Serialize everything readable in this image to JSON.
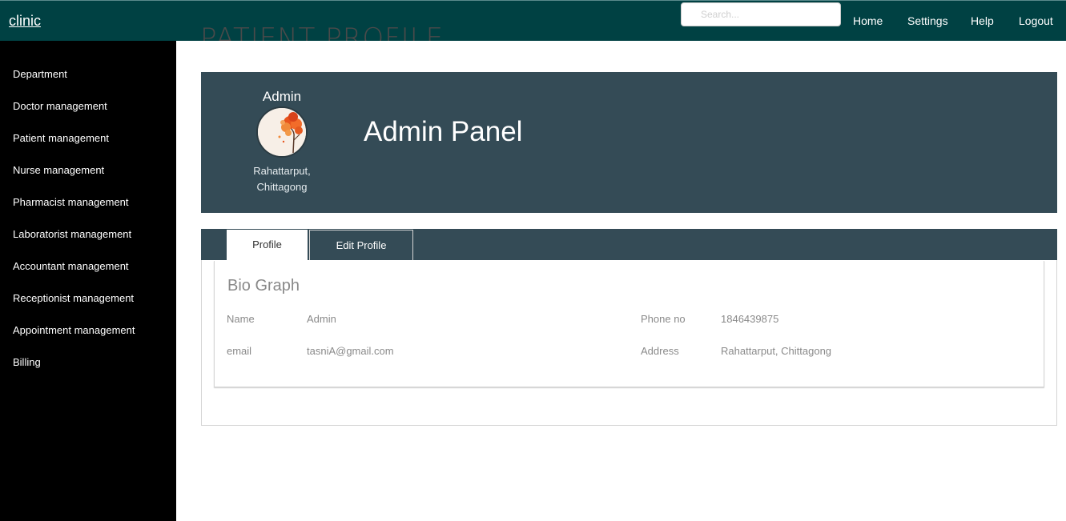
{
  "app": {
    "brand": "clinic"
  },
  "header": {
    "search_placeholder": "Search...",
    "nav": [
      "Home",
      "Settings",
      "Help",
      "Logout"
    ]
  },
  "sidebar": {
    "items": [
      {
        "label": "Department"
      },
      {
        "label": "Doctor management"
      },
      {
        "label": "Patient management"
      },
      {
        "label": "Nurse management"
      },
      {
        "label": "Pharmacist management"
      },
      {
        "label": "Laboratorist management"
      },
      {
        "label": "Accountant management"
      },
      {
        "label": "Receptionist management"
      },
      {
        "label": "Appointment management"
      },
      {
        "label": "Billing"
      }
    ]
  },
  "page": {
    "heading": "PATIENT PROFILE"
  },
  "profile": {
    "user": "Admin",
    "location_line1": "Rahattarput,",
    "location_line2": "Chittagong",
    "panel_title": "Admin Panel",
    "avatar_icon": "tree-avatar-icon"
  },
  "tabs": [
    {
      "label": "Profile",
      "active": true
    },
    {
      "label": "Edit Profile",
      "active": false
    }
  ],
  "bio": {
    "title": "Bio Graph",
    "rows": [
      {
        "left_label": "Name",
        "left_value": "Admin",
        "right_label": "Phone no",
        "right_value": "1846439875"
      },
      {
        "left_label": "email",
        "left_value": "tasniA@gmail.com",
        "right_label": "Address",
        "right_value": "Rahattarput, Chittagong"
      }
    ]
  },
  "colors": {
    "topbar": "#004143",
    "sidebar": "#000000",
    "banner": "#344b56",
    "text_muted": "#8a8a8a"
  }
}
